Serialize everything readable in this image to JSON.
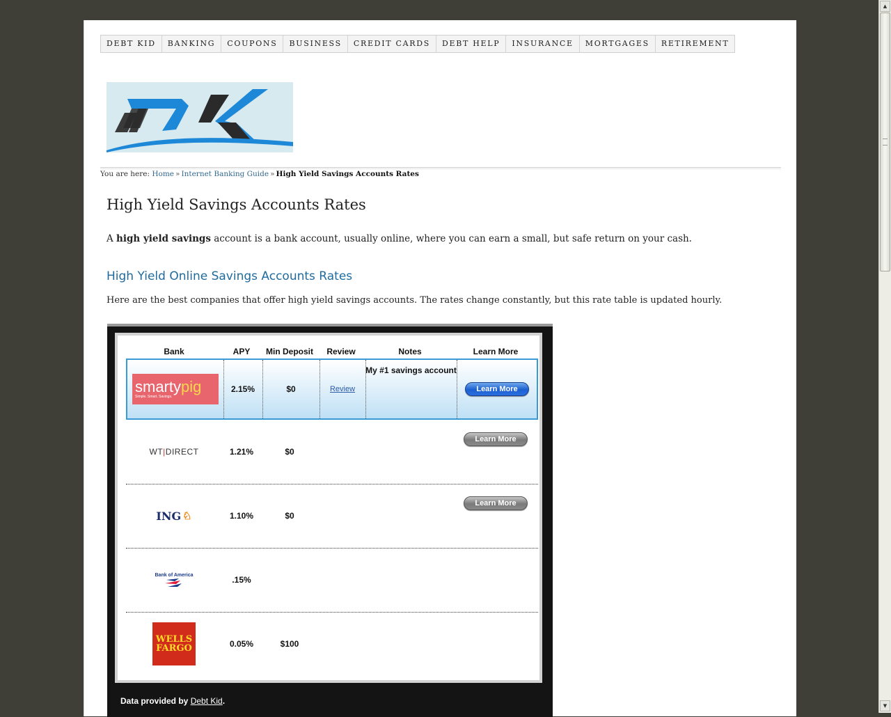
{
  "nav": {
    "items": [
      "DEBT KID",
      "BANKING",
      "COUPONS",
      "BUSINESS",
      "CREDIT CARDS",
      "DEBT HELP",
      "INSURANCE",
      "MORTGAGES",
      "RETIREMENT"
    ]
  },
  "logo": {
    "alt": "DK"
  },
  "breadcrumb": {
    "prefix": "You are here:",
    "home": "Home",
    "sep": "»",
    "guide": "Internet Banking Guide",
    "current": "High Yield Savings Accounts Rates"
  },
  "page": {
    "title": "High Yield Savings Accounts Rates",
    "intro_a": "A ",
    "intro_bold": "high yield savings",
    "intro_rest": " account is a bank account, usually online, where you can earn a small, but safe return on your cash.",
    "section_heading": "High Yield Online Savings Accounts Rates",
    "section_text": "Here are the best companies that offer high yield savings accounts. The rates change constantly, but this rate table is updated hourly."
  },
  "table": {
    "headers": {
      "bank": "Bank",
      "apy": "APY",
      "min": "Min Deposit",
      "review": "Review",
      "notes": "Notes",
      "more": "Learn More"
    },
    "featured": {
      "bank_logo_text": "smarty",
      "bank_logo_accent": "pig",
      "bank_tagline": "Simple. Smart. Savings.",
      "apy": "2.15%",
      "min": "$0",
      "review": "Review",
      "notes": "My #1 savings account",
      "more": "Learn More"
    },
    "rows": [
      {
        "logo_a": "WT",
        "logo_b": "DIRECT",
        "apy": "1.21%",
        "min": "$0",
        "more": "Learn More"
      },
      {
        "logo_a": "ING",
        "logo_b": "🦁",
        "apy": "1.10%",
        "min": "$0",
        "more": "Learn More"
      },
      {
        "logo_a": "Bank of America",
        "apy": ".15%",
        "min": "",
        "more": ""
      },
      {
        "logo_a": "WELLS FARGO",
        "apy": "0.05%",
        "min": "$100",
        "more": ""
      }
    ]
  },
  "footer": {
    "prefix": "Data provided by ",
    "link": "Debt Kid",
    "suffix": "."
  },
  "colors": {
    "accent_blue": "#1f6b9e",
    "featured_border": "#3a9ad6",
    "wells_red": "#d12c1b"
  }
}
